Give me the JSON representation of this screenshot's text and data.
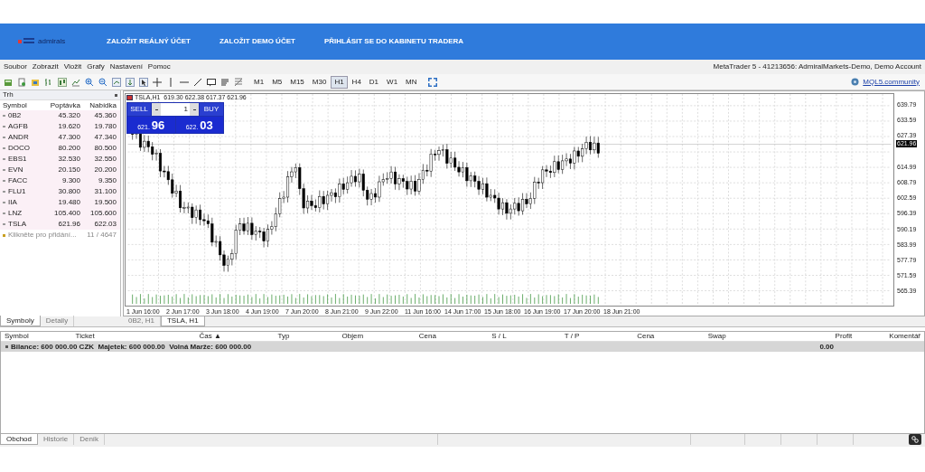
{
  "banner": {
    "logo_text": "admirals",
    "links": [
      "ZALOŽIT REÁLNÝ ÚČET",
      "ZALOŽIT DEMO ÚČET",
      "PŘIHLÁSIT SE DO KABINETU TRADERA"
    ]
  },
  "menu": [
    "Soubor",
    "Zobrazit",
    "Vložit",
    "Grafy",
    "Nastavení",
    "Pomoc"
  ],
  "window_title": "MetaTrader 5 - 41213656: AdmiralMarkets-Demo, Demo Account",
  "toolbar": {
    "timeframes": [
      {
        "label": "M1",
        "selected": false
      },
      {
        "label": "M5",
        "selected": false
      },
      {
        "label": "M15",
        "selected": false
      },
      {
        "label": "M30",
        "selected": false
      },
      {
        "label": "H1",
        "selected": true
      },
      {
        "label": "H4",
        "selected": false
      },
      {
        "label": "D1",
        "selected": false
      },
      {
        "label": "W1",
        "selected": false
      },
      {
        "label": "MN",
        "selected": false
      }
    ],
    "community_link": "MQL5.community"
  },
  "market_watch": {
    "title": "Trh",
    "columns": [
      "Symbol",
      "Poptávka",
      "Nabídka"
    ],
    "rows": [
      {
        "symbol": "0B2",
        "bid": "45.320",
        "ask": "45.360"
      },
      {
        "symbol": "AGFB",
        "bid": "19.620",
        "ask": "19.780"
      },
      {
        "symbol": "ANDR",
        "bid": "47.300",
        "ask": "47.340"
      },
      {
        "symbol": "DOCO",
        "bid": "80.200",
        "ask": "80.500"
      },
      {
        "symbol": "EBS1",
        "bid": "32.530",
        "ask": "32.550"
      },
      {
        "symbol": "EVN",
        "bid": "20.150",
        "ask": "20.200"
      },
      {
        "symbol": "FACC",
        "bid": "9.300",
        "ask": "9.350"
      },
      {
        "symbol": "FLU1",
        "bid": "30.800",
        "ask": "31.100"
      },
      {
        "symbol": "IIA",
        "bid": "19.480",
        "ask": "19.500"
      },
      {
        "symbol": "LNZ",
        "bid": "105.400",
        "ask": "105.600"
      },
      {
        "symbol": "TSLA",
        "bid": "621.96",
        "ask": "622.03"
      }
    ],
    "add_hint": "Klikněte pro přidání...",
    "count": "11 / 4647",
    "tabs": [
      {
        "label": "Symboly",
        "selected": true
      },
      {
        "label": "Detaily",
        "selected": false
      }
    ]
  },
  "chart": {
    "header": "TSLA,H1  619.30 622.38 617.37 621.96",
    "trade_panel": {
      "sell": "SELL",
      "buy": "BUY",
      "volume": "1",
      "bid_small": "621.",
      "bid_big": "96",
      "ask_small": "622.",
      "ask_big": "03"
    },
    "price_labels": [
      "639.79",
      "633.59",
      "627.39",
      "614.99",
      "608.79",
      "602.59",
      "596.39",
      "590.19",
      "583.99",
      "577.79",
      "571.59",
      "565.39"
    ],
    "current_price": "621.96",
    "time_labels": [
      "1 Jun 16:00",
      "2 Jun 17:00",
      "3 Jun 18:00",
      "4 Jun 19:00",
      "7 Jun 20:00",
      "8 Jun 21:00",
      "9 Jun 22:00",
      "11 Jun 16:00",
      "14 Jun 17:00",
      "15 Jun 18:00",
      "16 Jun 19:00",
      "17 Jun 20:00",
      "18 Jun 21:00"
    ]
  },
  "chart_tabs": [
    {
      "label": "0B2, H1",
      "selected": false
    },
    {
      "label": "TSLA, H1",
      "selected": true
    }
  ],
  "trade_table": {
    "columns": [
      "Symbol",
      "Ticket",
      "Čas ▲",
      "Typ",
      "Objem",
      "Cena",
      "S / L",
      "T / P",
      "Cena",
      "Swap",
      "Profit",
      "Komentář"
    ],
    "balance": "Bilance: 600 000.00 CZK  Majetek: 600 000.00  Volná Marže: 600 000.00",
    "profit": "0.00"
  },
  "terminal_tabs": [
    {
      "label": "Obchod",
      "selected": true
    },
    {
      "label": "Historie",
      "selected": false
    },
    {
      "label": "Deník",
      "selected": false
    }
  ]
}
